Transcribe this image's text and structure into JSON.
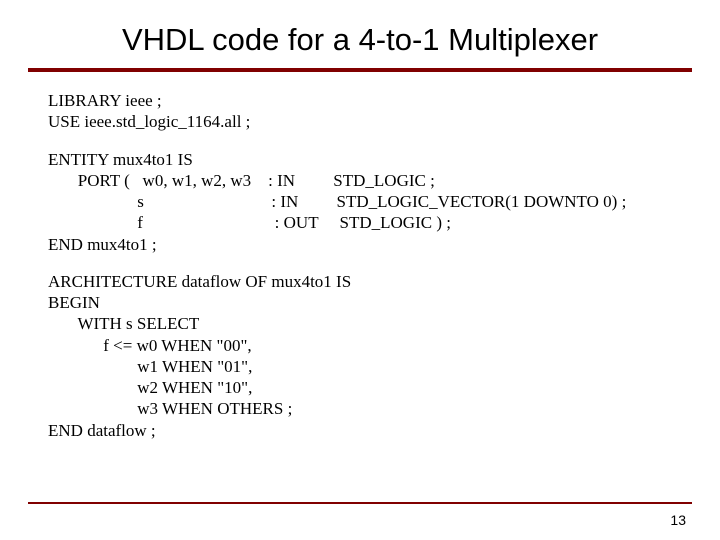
{
  "title": "VHDL code for a 4-to-1 Multiplexer",
  "lib_block": "LIBRARY ieee ;\nUSE ieee.std_logic_1164.all ;",
  "entity_block": "ENTITY mux4to1 IS\n       PORT (   w0, w1, w2, w3    : IN         STD_LOGIC ;\n                     s                              : IN         STD_LOGIC_VECTOR(1 DOWNTO 0) ;\n                     f                               : OUT     STD_LOGIC ) ;\nEND mux4to1 ;",
  "arch_block": "ARCHITECTURE dataflow OF mux4to1 IS\nBEGIN\n       WITH s SELECT\n             f <= w0 WHEN \"00\",\n                     w1 WHEN \"01\",\n                     w2 WHEN \"10\",\n                     w3 WHEN OTHERS ;\nEND dataflow ;",
  "page_number": "13"
}
